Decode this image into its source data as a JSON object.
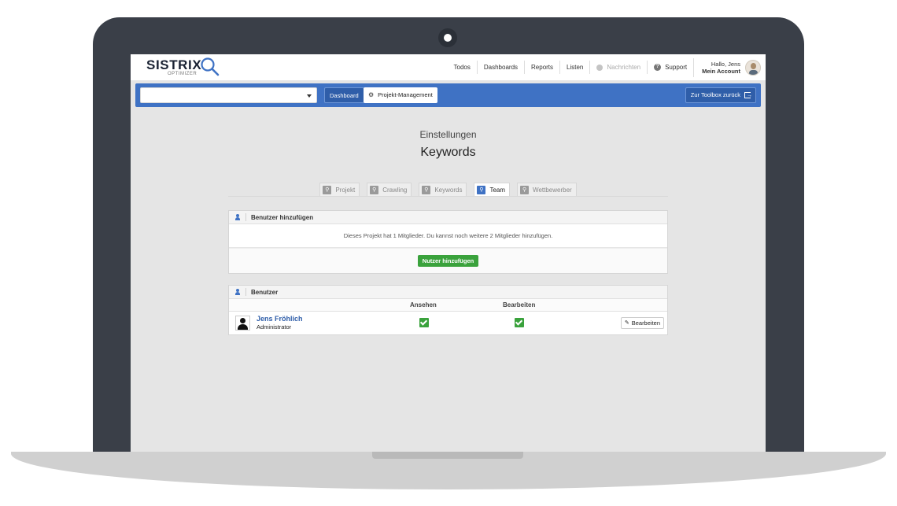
{
  "logo": {
    "word": "SISTRIX",
    "sub": "OPTIMIZER"
  },
  "nav": {
    "items": [
      "Todos",
      "Dashboards",
      "Reports",
      "Listen"
    ],
    "messages": "Nachrichten",
    "support": "Support",
    "greeting": "Hallo, Jens",
    "account": "Mein Account"
  },
  "toolbar": {
    "project_select_value": "",
    "dashboard": "Dashboard",
    "project_management": "Projekt-Management",
    "back": "Zur Toolbox zurück"
  },
  "page": {
    "pre_title": "Einstellungen",
    "title": "Keywords"
  },
  "tabs": [
    {
      "label": "Projekt",
      "active": false
    },
    {
      "label": "Crawling",
      "active": false
    },
    {
      "label": "Keywords",
      "active": false
    },
    {
      "label": "Team",
      "active": true
    },
    {
      "label": "Wettbewerber",
      "active": false
    }
  ],
  "add_user": {
    "heading": "Benutzer hinzufügen",
    "info": "Dieses Projekt hat 1 Mitglieder. Du kannst noch weitere 2 Mitglieder hinzufügen.",
    "button": "Nutzer hinzufügen"
  },
  "users": {
    "heading": "Benutzer",
    "columns": {
      "view": "Ansehen",
      "edit": "Bearbeiten"
    },
    "rows": [
      {
        "name": "Jens Fröhlich",
        "role": "Administrator",
        "can_view": true,
        "can_edit": true,
        "edit_button": "Bearbeiten"
      }
    ]
  },
  "colors": {
    "brand_blue": "#3f72c4",
    "success_green": "#3aa23c",
    "frame": "#3a3f48"
  }
}
